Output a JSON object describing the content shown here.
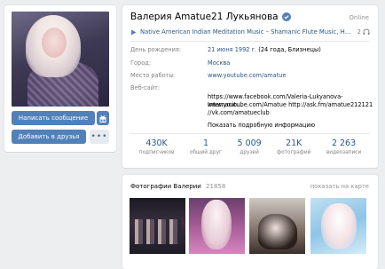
{
  "profile": {
    "name": "Валерия Amatue21 Лукьянова",
    "online": "Online",
    "status": {
      "text": "Native American Indian Meditation Music – Shamanic Flute Music, Healing M",
      "number": "2"
    }
  },
  "actions": {
    "message": "Написать сообщение",
    "add_friend": "Добавить в друзья",
    "more": "•••"
  },
  "info": {
    "birthday_label": "День рождения:",
    "birthday_value": "21 июня 1992 г.",
    "birthday_extra": "(24 года, Близнецы)",
    "city_label": "Город:",
    "city_value": "Москва",
    "work_label": "Место работы:",
    "work_value": "www.youtube.com/amatue",
    "site_label": "Веб-сайт:",
    "site_lines": [
      "https://www.facebook.com/Valeria-Lukyanova-Internacio...",
      "www.youtube.com/Amatue http://ask.fm/amatue212121",
      "//vk.com/amatueclub"
    ],
    "more_info": "Показать подробную информацию"
  },
  "stats": [
    {
      "value": "430K",
      "label": "подписчиков"
    },
    {
      "value": "1",
      "label": "общий друг"
    },
    {
      "value": "5 009",
      "label": "друзей"
    },
    {
      "value": "21K",
      "label": "фотографий"
    },
    {
      "value": "2 263",
      "label": "видеозаписи"
    }
  ],
  "photos": {
    "title": "Фотографии Валерии",
    "count": "21858",
    "map_link": "показать на карте"
  },
  "colors": {
    "link": "#2a5885",
    "button": "#5181b8",
    "muted": "#828282",
    "background": "#edeef0"
  },
  "icons": {
    "verified": "verified-check-icon",
    "play": "play-icon",
    "headphones": "headphones-icon",
    "gift": "gift-icon"
  }
}
